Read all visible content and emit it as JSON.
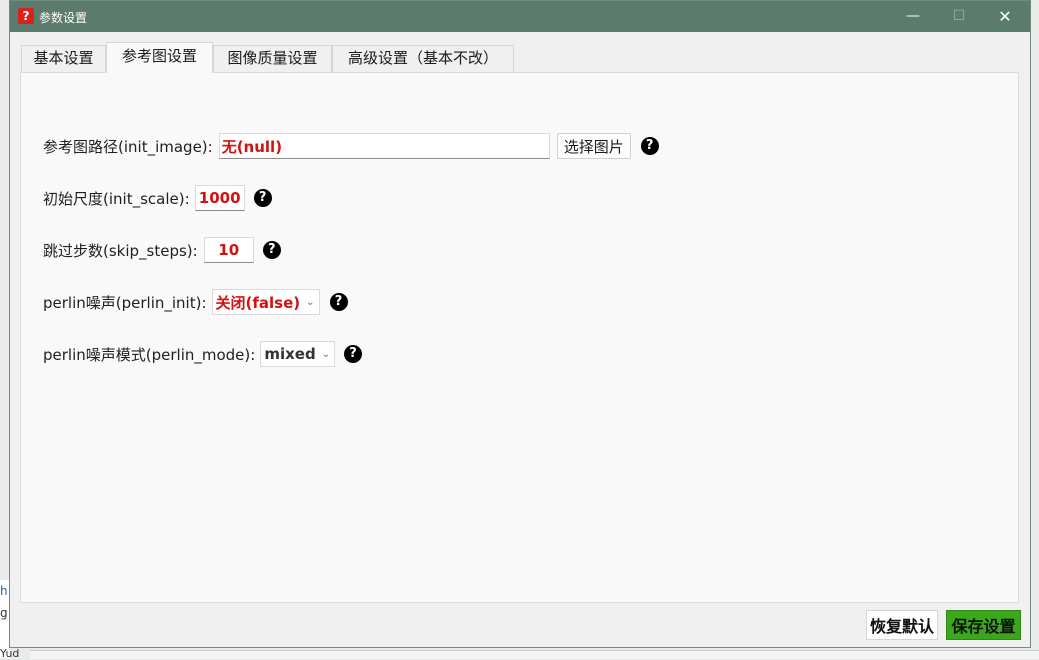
{
  "window": {
    "title": "参数设置",
    "icon": "?"
  },
  "tabs": [
    {
      "label": "基本设置",
      "active": false
    },
    {
      "label": "参考图设置",
      "active": true
    },
    {
      "label": "图像质量设置",
      "active": false
    },
    {
      "label": "高级设置（基本不改）",
      "active": false
    }
  ],
  "form": {
    "init_image": {
      "label": "参考图路径(init_image):",
      "value": "无(null)",
      "button": "选择图片"
    },
    "init_scale": {
      "label": "初始尺度(init_scale):",
      "value": "1000"
    },
    "skip_steps": {
      "label": "跳过步数(skip_steps):",
      "value": "10"
    },
    "perlin_init": {
      "label": "perlin噪声(perlin_init):",
      "value": "关闭(false)"
    },
    "perlin_mode": {
      "label": "perlin噪声模式(perlin_mode):",
      "value": "mixed"
    }
  },
  "help_glyph": "?",
  "footer": {
    "reset_label": "恢复默认",
    "save_label": "保存设置"
  },
  "background_fragments": [
    "h",
    "g",
    "Yud"
  ],
  "colors": {
    "titlebar": "#5b7b6d",
    "value_red": "#d51010",
    "save_green": "#3aa81a"
  }
}
